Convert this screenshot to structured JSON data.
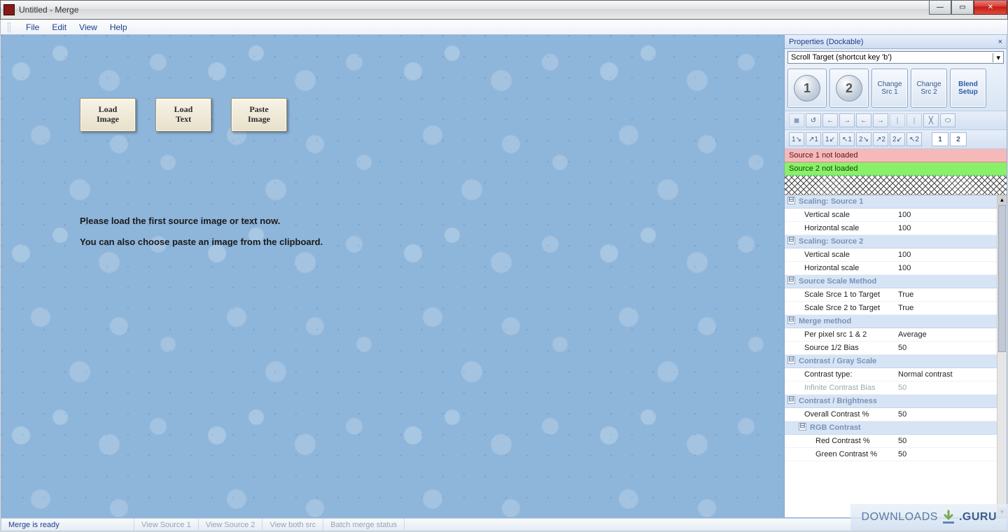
{
  "window": {
    "title": "Untitled - Merge"
  },
  "menu": {
    "file": "File",
    "edit": "Edit",
    "view": "View",
    "help": "Help"
  },
  "canvas": {
    "load_image": "Load\nImage",
    "load_text": "Load\nText",
    "paste_image": "Paste\nImage",
    "msg1": "Please load the first source image or text now.",
    "msg2": "You can also choose paste an image from the clipboard."
  },
  "panel": {
    "title": "Properties (Dockable)",
    "selector": "Scroll Target  (shortcut key 'b')",
    "big": {
      "b1": "1",
      "b2": "2",
      "c1a": "Change",
      "c1b": "Src 1",
      "c2a": "Change",
      "c2b": "Src 2",
      "bsa": "Blend",
      "bsb": "Setup"
    },
    "src1": "Source 1 not loaded",
    "src2": "Source 2 not loaded",
    "tb_1": "1",
    "tb_2": "2"
  },
  "props": {
    "cat_s1": "Scaling: Source 1",
    "s1_vk": "Vertical scale",
    "s1_vv": "100",
    "s1_hk": "Horizontal scale",
    "s1_hv": "100",
    "cat_s2": "Scaling: Source 2",
    "s2_vk": "Vertical scale",
    "s2_vv": "100",
    "s2_hk": "Horizontal scale",
    "s2_hv": "100",
    "cat_sm": "Source Scale Method",
    "sm1k": "Scale Srce 1 to Target",
    "sm1v": "True",
    "sm2k": "Scale Srce 2 to Target",
    "sm2v": "True",
    "cat_mm": "Merge method",
    "mm1k": "Per pixel src 1 & 2",
    "mm1v": "Average",
    "mm2k": "Source 1/2 Bias",
    "mm2v": "50",
    "cat_cg": "Contrast / Gray Scale",
    "cg1k": "Contrast type:",
    "cg1v": "Normal contrast",
    "cg2k": "Infinite Contrast Bias",
    "cg2v": "50",
    "cat_cb": "Contrast / Brightness",
    "cb1k": "Overall Contrast %",
    "cb1v": "50",
    "cat_rgb": "RGB Contrast",
    "rk": "Red Contrast %",
    "rv": "50",
    "gk": "Green Contrast %",
    "gv": "50"
  },
  "status": {
    "ready": "Merge is ready",
    "v1": "View Source 1",
    "v2": "View Source 2",
    "vb": "View both src",
    "bm": "Batch merge status"
  },
  "watermark": {
    "a": "DOWNLOADS",
    "b": ".GURU"
  }
}
